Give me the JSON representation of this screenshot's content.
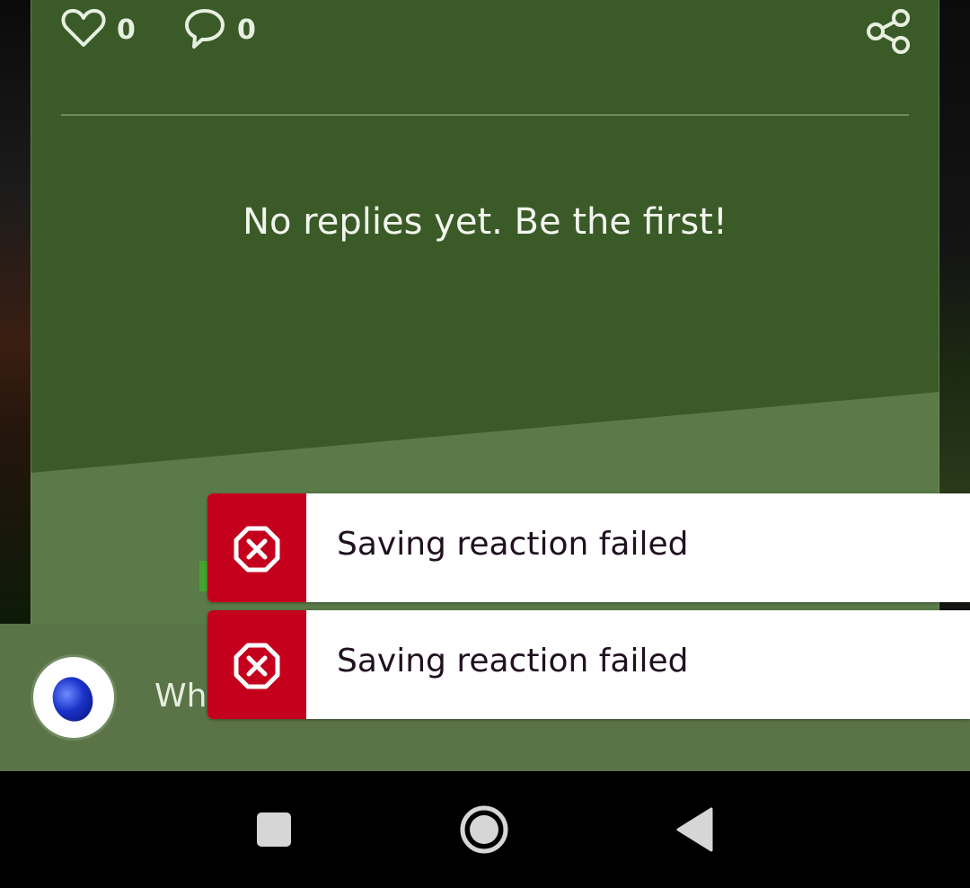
{
  "post": {
    "likes": {
      "icon": "heart-outline-icon",
      "count": "0"
    },
    "comments": {
      "icon": "speech-bubble-icon",
      "count": "0"
    },
    "share_icon": "share-icon",
    "empty_replies": "No replies yet. Be the first!"
  },
  "composer": {
    "avatar_icon": "blue-gem-avatar",
    "input_placeholder_visible": "Wha"
  },
  "toasts": [
    {
      "icon": "error-octagon-x-icon",
      "message": "Saving reaction failed"
    },
    {
      "icon": "error-octagon-x-icon",
      "message": "Saving reaction failed"
    }
  ],
  "navbar": {
    "recent_icon": "square-recents-icon",
    "home_icon": "circle-home-icon",
    "back_icon": "triangle-back-icon"
  },
  "colors": {
    "card_dark": "#3a5a27",
    "card_light": "#5a7a48",
    "composer_bg": "#5a7347",
    "toast_error": "#c5001c",
    "toast_bg": "#ffffff"
  }
}
